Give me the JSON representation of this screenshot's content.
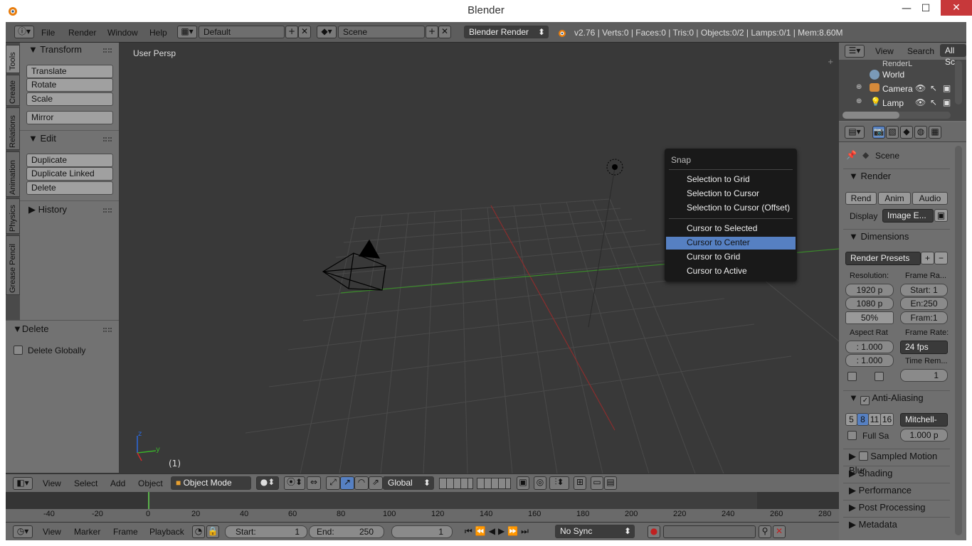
{
  "window": {
    "title": "Blender",
    "minimize": "—",
    "maximize": "☐",
    "close": "✕"
  },
  "header": {
    "menus": [
      "File",
      "Render",
      "Window",
      "Help"
    ],
    "layout": "Default",
    "scene": "Scene",
    "engine": "Blender Render",
    "stats": "v2.76 | Verts:0 | Faces:0 | Tris:0 | Objects:0/2 | Lamps:0/1 | Mem:8.60M"
  },
  "left_tabs": [
    "Tools",
    "Create",
    "Relations",
    "Animation",
    "Physics",
    "Grease Pencil"
  ],
  "tool_panel": {
    "transform_header": "Transform",
    "transform_buttons": [
      "Translate",
      "Rotate",
      "Scale"
    ],
    "mirror": "Mirror",
    "edit_header": "Edit",
    "edit_buttons": [
      "Duplicate",
      "Duplicate Linked",
      "Delete"
    ],
    "history_header": "History"
  },
  "operator_panel": {
    "header": "Delete",
    "checkbox_label": "Delete Globally"
  },
  "viewport": {
    "label": "User Persp",
    "frame": "(1)",
    "axis_x": "y",
    "axis_z": "z"
  },
  "snap_menu": {
    "title": "Snap",
    "group1": [
      "Selection to Grid",
      "Selection to Cursor",
      "Selection to Cursor (Offset)"
    ],
    "group2": [
      "Cursor to Selected",
      "Cursor to Center",
      "Cursor to Grid",
      "Cursor to Active"
    ],
    "highlighted": "Cursor to Center"
  },
  "view_header": {
    "menus": [
      "View",
      "Select",
      "Add",
      "Object"
    ],
    "mode": "Object Mode",
    "orientation": "Global"
  },
  "timeline": {
    "ticks": [
      "-40",
      "-20",
      "0",
      "20",
      "40",
      "60",
      "80",
      "100",
      "120",
      "140",
      "160",
      "180",
      "200",
      "220",
      "240",
      "260",
      "280"
    ],
    "menus": [
      "View",
      "Marker",
      "Frame",
      "Playback"
    ],
    "start_label": "Start:",
    "start": "1",
    "end_label": "End:",
    "end": "250",
    "current": "1",
    "sync": "No Sync"
  },
  "outliner": {
    "menus": [
      "View",
      "Search"
    ],
    "filter": "All Sc",
    "items": [
      "RenderL",
      "World",
      "Camera",
      "Lamp"
    ]
  },
  "properties": {
    "context": "Scene",
    "render_header": "Render",
    "render_buttons": [
      "Rend",
      "Anim",
      "Audio"
    ],
    "display_label": "Display",
    "display_value": "Image E...",
    "dimensions_header": "Dimensions",
    "presets": "Render Presets",
    "resolution_label": "Resolution:",
    "res_x": "1920 p",
    "res_y": "1080 p",
    "res_pct": "50%",
    "frame_range_label": "Frame Ra...",
    "frame_start": "Start: 1",
    "frame_end": "En:250",
    "frame_step": "Fram:1",
    "aspect_label": "Aspect Rat",
    "aspect_x": ": 1.000",
    "aspect_y": ": 1.000",
    "frame_rate_label": "Frame Rate:",
    "fps": "24 fps",
    "time_remap_label": "Time Rem...",
    "time_remap_value": "1",
    "aa_header": "Anti-Aliasing",
    "aa_samples": [
      "5",
      "8",
      "11",
      "16"
    ],
    "aa_selected": "8",
    "aa_filter": "Mitchell-",
    "full_sample": "Full Sa",
    "aa_size": "1.000 p",
    "collapsed_sections": [
      "Sampled Motion Blur",
      "Shading",
      "Performance",
      "Post Processing",
      "Metadata"
    ]
  },
  "colors": {
    "accent": "#5680c2",
    "menu_bg": "#191919",
    "viewport_bg": "#393939",
    "grid": "#4a4a4a",
    "x_axis": "#8b2d2d",
    "y_axis": "#3a8a2a"
  }
}
